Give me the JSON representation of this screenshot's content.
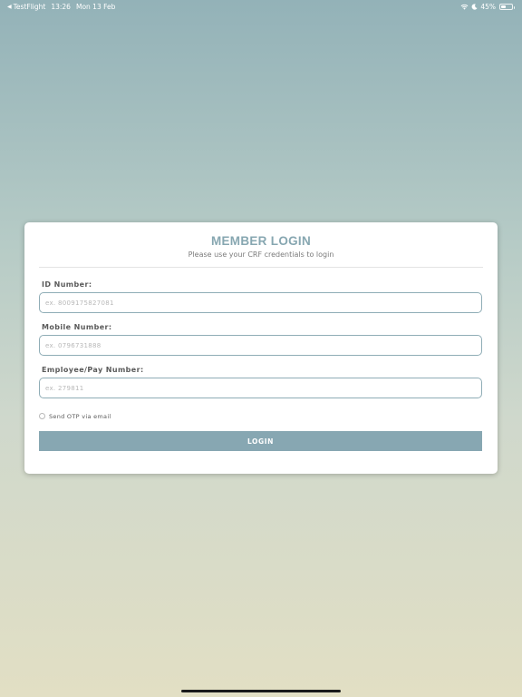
{
  "status_bar": {
    "back_app": "TestFlight",
    "time": "13:26",
    "date": "Mon 13 Feb",
    "battery_percent": "45%",
    "battery_level": 0.45,
    "icons": [
      "back-arrow-icon",
      "wifi-icon",
      "moon-icon",
      "battery-icon"
    ]
  },
  "login": {
    "title": "MEMBER LOGIN",
    "subtitle": "Please use your CRF credentials to login",
    "fields": [
      {
        "label": "ID Number:",
        "placeholder": "ex. 8009175827081",
        "value": ""
      },
      {
        "label": "Mobile Number:",
        "placeholder": "ex. 0796731888",
        "value": ""
      },
      {
        "label": "Employee/Pay Number:",
        "placeholder": "ex. 279811",
        "value": ""
      }
    ],
    "otp_option": {
      "label": "Send OTP via email",
      "checked": false
    },
    "submit_label": "LOGIN"
  },
  "colors": {
    "accent": "#87a7b2",
    "title": "#87a7b1",
    "input_border": "#8fadb6"
  }
}
